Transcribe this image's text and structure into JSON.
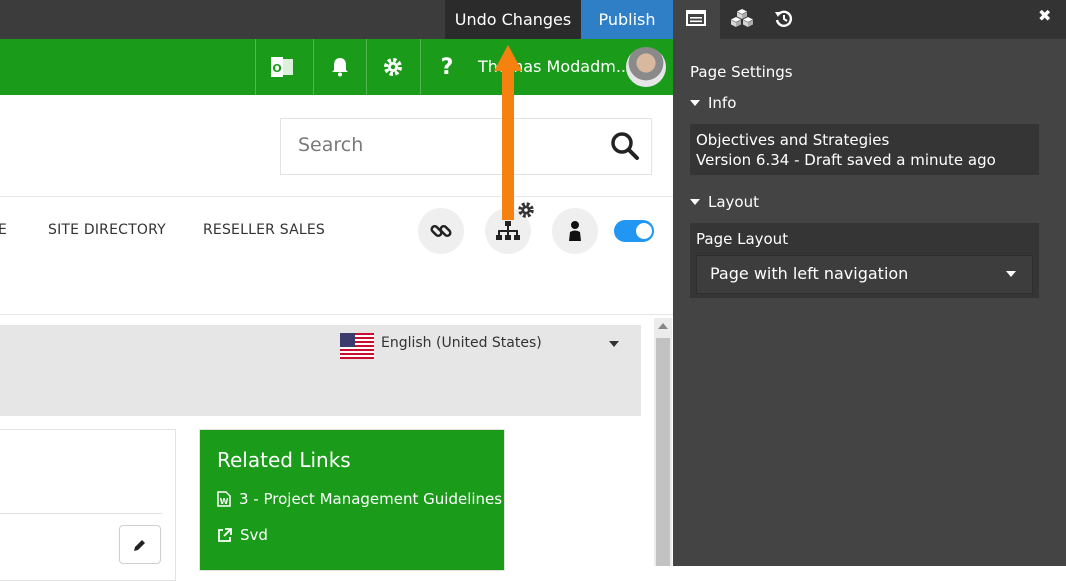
{
  "toolbar": {
    "undo_label": "Undo Changes",
    "publish_label": "Publish"
  },
  "header": {
    "user_name": "Thomas Modadm...",
    "icons": [
      "outlook-icon",
      "bell-icon",
      "gear-icon",
      "help-icon"
    ],
    "help_glyph": "?"
  },
  "search": {
    "placeholder": "Search"
  },
  "nav": {
    "items": [
      {
        "label": "E"
      },
      {
        "label": "SITE DIRECTORY"
      },
      {
        "label": "RESELLER SALES"
      }
    ],
    "toggle_on": true
  },
  "language": {
    "selected": "English (United States)"
  },
  "related_links": {
    "title": "Related Links",
    "items": [
      {
        "label": "3 - Project Management Guidelines",
        "icon": "word-doc-icon"
      },
      {
        "label": "Svd",
        "icon": "external-link-icon"
      }
    ]
  },
  "panel": {
    "title": "Page Settings",
    "close_glyph": "✖",
    "info_section": {
      "label": "Info",
      "page_title": "Objectives and Strategies",
      "version": "Version 6.34 - Draft saved a minute ago"
    },
    "layout_section": {
      "label": "Layout",
      "field_label": "Page Layout",
      "selected": "Page with left navigation"
    }
  },
  "colors": {
    "brand_green": "#1a9c1a",
    "publish_blue": "#2f7fc6",
    "toggle_blue": "#2196f3",
    "annotation_orange": "#f5820e",
    "panel_bg": "#444444"
  }
}
